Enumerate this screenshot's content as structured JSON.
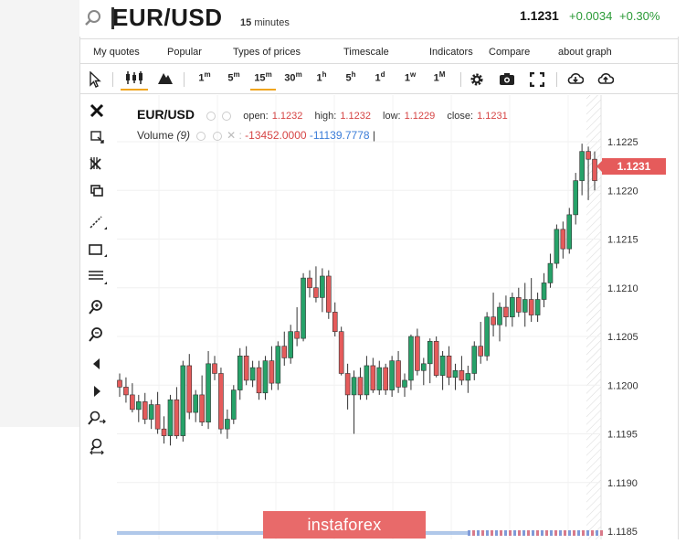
{
  "header": {
    "symbol": "EUR/USD",
    "interval_value": "15",
    "interval_unit": "minutes",
    "price": "1.1231",
    "change": "+0.0034",
    "change_pct": "+0.30%"
  },
  "menu": [
    "My quotes",
    "Popular",
    "Types of prices",
    "Timescale",
    "Indicators",
    "Compare",
    "about graph"
  ],
  "timeframes": [
    {
      "num": "1",
      "unit": "m"
    },
    {
      "num": "5",
      "unit": "m"
    },
    {
      "num": "15",
      "unit": "m"
    },
    {
      "num": "30",
      "unit": "m"
    },
    {
      "num": "1",
      "unit": "h"
    },
    {
      "num": "5",
      "unit": "h"
    },
    {
      "num": "1",
      "unit": "d"
    },
    {
      "num": "1",
      "unit": "w"
    },
    {
      "num": "1",
      "unit": "M"
    }
  ],
  "legend": {
    "symbol": "EUR/USD",
    "open_label": "open:",
    "open": "1.1232",
    "high_label": "high:",
    "high": "1.1232",
    "low_label": "low:",
    "low": "1.1229",
    "close_label": "close:",
    "close": "1.1231",
    "volume_label": "Volume",
    "volume_period": "(9)",
    "volume_v1": "-13452.0000",
    "volume_v2": "-11139.7778"
  },
  "watermark": "instaforex",
  "current_price_tag": "1.1231",
  "colors": {
    "up": "#26a269",
    "down": "#e55b5b",
    "accent": "#f0a51e",
    "positive": "#2a9a36"
  },
  "chart_data": {
    "type": "candlestick",
    "y_ticks": [
      "1.1225",
      "1.1220",
      "1.1215",
      "1.1210",
      "1.1205",
      "1.1200",
      "1.1195",
      "1.1190",
      "1.1185"
    ],
    "ylim": [
      1.1184,
      1.1228
    ],
    "current_price": 1.1231,
    "candles": [
      {
        "o": 1.12005,
        "h": 1.12012,
        "l": 1.11988,
        "c": 1.11998
      },
      {
        "o": 1.11998,
        "h": 1.12008,
        "l": 1.11982,
        "c": 1.1199
      },
      {
        "o": 1.1199,
        "h": 1.12002,
        "l": 1.11972,
        "c": 1.11975
      },
      {
        "o": 1.11975,
        "h": 1.1199,
        "l": 1.11962,
        "c": 1.11983
      },
      {
        "o": 1.11983,
        "h": 1.11992,
        "l": 1.1196,
        "c": 1.11965
      },
      {
        "o": 1.11965,
        "h": 1.11985,
        "l": 1.11955,
        "c": 1.1198
      },
      {
        "o": 1.1198,
        "h": 1.11993,
        "l": 1.1195,
        "c": 1.11955
      },
      {
        "o": 1.11955,
        "h": 1.11968,
        "l": 1.1194,
        "c": 1.11948
      },
      {
        "o": 1.11948,
        "h": 1.1199,
        "l": 1.11938,
        "c": 1.11985
      },
      {
        "o": 1.11985,
        "h": 1.11998,
        "l": 1.11945,
        "c": 1.11948
      },
      {
        "o": 1.11948,
        "h": 1.12025,
        "l": 1.11942,
        "c": 1.1202
      },
      {
        "o": 1.1202,
        "h": 1.12032,
        "l": 1.11965,
        "c": 1.11972
      },
      {
        "o": 1.11972,
        "h": 1.11995,
        "l": 1.11962,
        "c": 1.1199
      },
      {
        "o": 1.1199,
        "h": 1.1201,
        "l": 1.11958,
        "c": 1.11962
      },
      {
        "o": 1.11962,
        "h": 1.12035,
        "l": 1.11955,
        "c": 1.12022
      },
      {
        "o": 1.12022,
        "h": 1.1203,
        "l": 1.12005,
        "c": 1.12012
      },
      {
        "o": 1.12012,
        "h": 1.12018,
        "l": 1.1195,
        "c": 1.11955
      },
      {
        "o": 1.11955,
        "h": 1.11975,
        "l": 1.11945,
        "c": 1.11965
      },
      {
        "o": 1.11965,
        "h": 1.12,
        "l": 1.1196,
        "c": 1.11995
      },
      {
        "o": 1.11995,
        "h": 1.12038,
        "l": 1.11985,
        "c": 1.1203
      },
      {
        "o": 1.1203,
        "h": 1.1204,
        "l": 1.12,
        "c": 1.12005
      },
      {
        "o": 1.12005,
        "h": 1.12025,
        "l": 1.11998,
        "c": 1.12018
      },
      {
        "o": 1.12018,
        "h": 1.12025,
        "l": 1.11985,
        "c": 1.11992
      },
      {
        "o": 1.11992,
        "h": 1.1203,
        "l": 1.11985,
        "c": 1.12025
      },
      {
        "o": 1.12025,
        "h": 1.1204,
        "l": 1.11995,
        "c": 1.12002
      },
      {
        "o": 1.12002,
        "h": 1.12045,
        "l": 1.11995,
        "c": 1.1204
      },
      {
        "o": 1.1204,
        "h": 1.12055,
        "l": 1.1202,
        "c": 1.12028
      },
      {
        "o": 1.12028,
        "h": 1.12062,
        "l": 1.12022,
        "c": 1.12055
      },
      {
        "o": 1.12055,
        "h": 1.1208,
        "l": 1.1204,
        "c": 1.12048
      },
      {
        "o": 1.12048,
        "h": 1.12115,
        "l": 1.12045,
        "c": 1.1211
      },
      {
        "o": 1.1211,
        "h": 1.12118,
        "l": 1.1209,
        "c": 1.121
      },
      {
        "o": 1.121,
        "h": 1.12122,
        "l": 1.12085,
        "c": 1.1209
      },
      {
        "o": 1.1209,
        "h": 1.1212,
        "l": 1.12075,
        "c": 1.12112
      },
      {
        "o": 1.12112,
        "h": 1.12118,
        "l": 1.12068,
        "c": 1.12075
      },
      {
        "o": 1.12075,
        "h": 1.12085,
        "l": 1.1205,
        "c": 1.12055
      },
      {
        "o": 1.12055,
        "h": 1.1206,
        "l": 1.1201,
        "c": 1.12012
      },
      {
        "o": 1.12012,
        "h": 1.12022,
        "l": 1.11975,
        "c": 1.1199
      },
      {
        "o": 1.1199,
        "h": 1.12015,
        "l": 1.1195,
        "c": 1.12008
      },
      {
        "o": 1.12008,
        "h": 1.12018,
        "l": 1.11985,
        "c": 1.1199
      },
      {
        "o": 1.1199,
        "h": 1.1203,
        "l": 1.11985,
        "c": 1.1202
      },
      {
        "o": 1.1202,
        "h": 1.12028,
        "l": 1.11992,
        "c": 1.11995
      },
      {
        "o": 1.11995,
        "h": 1.12025,
        "l": 1.1199,
        "c": 1.12018
      },
      {
        "o": 1.12018,
        "h": 1.12022,
        "l": 1.1199,
        "c": 1.11995
      },
      {
        "o": 1.11995,
        "h": 1.1203,
        "l": 1.11988,
        "c": 1.12025
      },
      {
        "o": 1.12025,
        "h": 1.12035,
        "l": 1.11992,
        "c": 1.11998
      },
      {
        "o": 1.11998,
        "h": 1.12012,
        "l": 1.11988,
        "c": 1.12005
      },
      {
        "o": 1.12005,
        "h": 1.12052,
        "l": 1.11995,
        "c": 1.1205
      },
      {
        "o": 1.1205,
        "h": 1.12058,
        "l": 1.1201,
        "c": 1.12015
      },
      {
        "o": 1.12015,
        "h": 1.12028,
        "l": 1.12,
        "c": 1.12022
      },
      {
        "o": 1.12022,
        "h": 1.12048,
        "l": 1.12002,
        "c": 1.12045
      },
      {
        "o": 1.12045,
        "h": 1.1205,
        "l": 1.12008,
        "c": 1.1201
      },
      {
        "o": 1.1201,
        "h": 1.12035,
        "l": 1.11995,
        "c": 1.1203
      },
      {
        "o": 1.1203,
        "h": 1.1204,
        "l": 1.12,
        "c": 1.12008
      },
      {
        "o": 1.12008,
        "h": 1.12022,
        "l": 1.11995,
        "c": 1.12015
      },
      {
        "o": 1.12015,
        "h": 1.1203,
        "l": 1.12,
        "c": 1.12005
      },
      {
        "o": 1.12005,
        "h": 1.1202,
        "l": 1.11992,
        "c": 1.12012
      },
      {
        "o": 1.12012,
        "h": 1.12045,
        "l": 1.12005,
        "c": 1.1204
      },
      {
        "o": 1.1204,
        "h": 1.12065,
        "l": 1.12022,
        "c": 1.1203
      },
      {
        "o": 1.1203,
        "h": 1.12075,
        "l": 1.12025,
        "c": 1.1207
      },
      {
        "o": 1.1207,
        "h": 1.12095,
        "l": 1.1205,
        "c": 1.12062
      },
      {
        "o": 1.12062,
        "h": 1.12085,
        "l": 1.12045,
        "c": 1.1208
      },
      {
        "o": 1.1208,
        "h": 1.12092,
        "l": 1.1206,
        "c": 1.1207
      },
      {
        "o": 1.1207,
        "h": 1.12095,
        "l": 1.1206,
        "c": 1.1209
      },
      {
        "o": 1.1209,
        "h": 1.121,
        "l": 1.1207,
        "c": 1.12075
      },
      {
        "o": 1.12075,
        "h": 1.12105,
        "l": 1.1206,
        "c": 1.12088
      },
      {
        "o": 1.12088,
        "h": 1.1211,
        "l": 1.12065,
        "c": 1.12072
      },
      {
        "o": 1.12072,
        "h": 1.12095,
        "l": 1.12065,
        "c": 1.12088
      },
      {
        "o": 1.12088,
        "h": 1.12115,
        "l": 1.1208,
        "c": 1.12105
      },
      {
        "o": 1.12105,
        "h": 1.12135,
        "l": 1.121,
        "c": 1.12125
      },
      {
        "o": 1.12125,
        "h": 1.12165,
        "l": 1.1212,
        "c": 1.1216
      },
      {
        "o": 1.1216,
        "h": 1.12168,
        "l": 1.1213,
        "c": 1.1214
      },
      {
        "o": 1.1214,
        "h": 1.12182,
        "l": 1.12135,
        "c": 1.12175
      },
      {
        "o": 1.12175,
        "h": 1.12218,
        "l": 1.12165,
        "c": 1.1221
      },
      {
        "o": 1.1221,
        "h": 1.12248,
        "l": 1.12195,
        "c": 1.1224
      },
      {
        "o": 1.1224,
        "h": 1.12245,
        "l": 1.1219,
        "c": 1.12232
      },
      {
        "o": 1.12232,
        "h": 1.1224,
        "l": 1.122,
        "c": 1.1221
      }
    ]
  }
}
